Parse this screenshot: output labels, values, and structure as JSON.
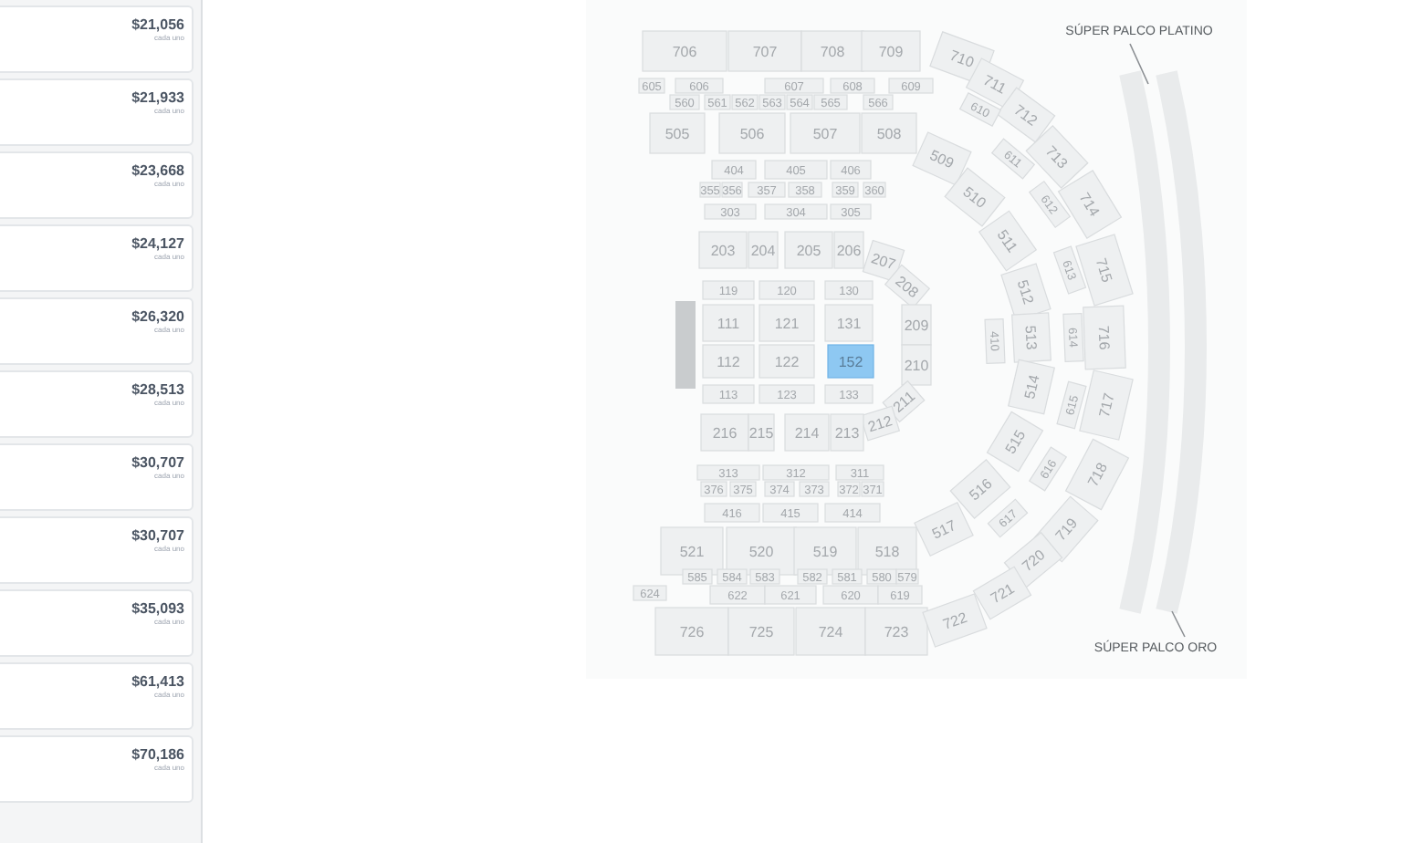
{
  "offers": [
    {
      "price": "$21,056",
      "note": "cada uno"
    },
    {
      "price": "$21,933",
      "note": "cada uno"
    },
    {
      "price": "$23,668",
      "note": "cada uno"
    },
    {
      "price": "$24,127",
      "note": "cada uno"
    },
    {
      "price": "$26,320",
      "note": "cada uno"
    },
    {
      "price": "$28,513",
      "note": "cada uno"
    },
    {
      "price": "$30,707",
      "note": "cada uno"
    },
    {
      "price": "$30,707",
      "note": "cada uno"
    },
    {
      "price": "$35,093",
      "note": "cada uno"
    },
    {
      "price": "$61,413",
      "note": "cada uno"
    },
    {
      "price": "$70,186",
      "note": "cada uno"
    }
  ],
  "seat_map": {
    "sections": [
      {
        "label": "706",
        "selected": false
      },
      {
        "label": "707",
        "selected": false
      },
      {
        "label": "708",
        "selected": false
      },
      {
        "label": "709",
        "selected": false
      },
      {
        "label": "605",
        "selected": false
      },
      {
        "label": "606",
        "selected": false
      },
      {
        "label": "607",
        "selected": false
      },
      {
        "label": "608",
        "selected": false
      },
      {
        "label": "609",
        "selected": false
      },
      {
        "label": "560",
        "selected": false
      },
      {
        "label": "561",
        "selected": false
      },
      {
        "label": "562",
        "selected": false
      },
      {
        "label": "563",
        "selected": false
      },
      {
        "label": "564",
        "selected": false
      },
      {
        "label": "565",
        "selected": false
      },
      {
        "label": "566",
        "selected": false
      },
      {
        "label": "505",
        "selected": false
      },
      {
        "label": "506",
        "selected": false
      },
      {
        "label": "507",
        "selected": false
      },
      {
        "label": "508",
        "selected": false
      },
      {
        "label": "404",
        "selected": false
      },
      {
        "label": "405",
        "selected": false
      },
      {
        "label": "406",
        "selected": false
      },
      {
        "label": "355",
        "selected": false
      },
      {
        "label": "356",
        "selected": false
      },
      {
        "label": "357",
        "selected": false
      },
      {
        "label": "358",
        "selected": false
      },
      {
        "label": "359",
        "selected": false
      },
      {
        "label": "360",
        "selected": false
      },
      {
        "label": "303",
        "selected": false
      },
      {
        "label": "304",
        "selected": false
      },
      {
        "label": "305",
        "selected": false
      },
      {
        "label": "203",
        "selected": false
      },
      {
        "label": "204",
        "selected": false
      },
      {
        "label": "205",
        "selected": false
      },
      {
        "label": "206",
        "selected": false
      },
      {
        "label": "207",
        "selected": false
      },
      {
        "label": "208",
        "selected": false
      },
      {
        "label": "119",
        "selected": false
      },
      {
        "label": "120",
        "selected": false
      },
      {
        "label": "130",
        "selected": false
      },
      {
        "label": "111",
        "selected": false
      },
      {
        "label": "121",
        "selected": false
      },
      {
        "label": "131",
        "selected": false
      },
      {
        "label": "209",
        "selected": false
      },
      {
        "label": "112",
        "selected": false
      },
      {
        "label": "122",
        "selected": false
      },
      {
        "label": "152",
        "selected": true
      },
      {
        "label": "210",
        "selected": false
      },
      {
        "label": "113",
        "selected": false
      },
      {
        "label": "123",
        "selected": false
      },
      {
        "label": "133",
        "selected": false
      },
      {
        "label": "211",
        "selected": false
      },
      {
        "label": "212",
        "selected": false
      },
      {
        "label": "216",
        "selected": false
      },
      {
        "label": "215",
        "selected": false
      },
      {
        "label": "214",
        "selected": false
      },
      {
        "label": "213",
        "selected": false
      },
      {
        "label": "313",
        "selected": false
      },
      {
        "label": "312",
        "selected": false
      },
      {
        "label": "311",
        "selected": false
      },
      {
        "label": "376",
        "selected": false
      },
      {
        "label": "375",
        "selected": false
      },
      {
        "label": "374",
        "selected": false
      },
      {
        "label": "373",
        "selected": false
      },
      {
        "label": "372",
        "selected": false
      },
      {
        "label": "371",
        "selected": false
      },
      {
        "label": "416",
        "selected": false
      },
      {
        "label": "415",
        "selected": false
      },
      {
        "label": "414",
        "selected": false
      },
      {
        "label": "521",
        "selected": false
      },
      {
        "label": "520",
        "selected": false
      },
      {
        "label": "519",
        "selected": false
      },
      {
        "label": "518",
        "selected": false
      },
      {
        "label": "585",
        "selected": false
      },
      {
        "label": "584",
        "selected": false
      },
      {
        "label": "583",
        "selected": false
      },
      {
        "label": "582",
        "selected": false
      },
      {
        "label": "581",
        "selected": false
      },
      {
        "label": "580",
        "selected": false
      },
      {
        "label": "579",
        "selected": false
      },
      {
        "label": "624",
        "selected": false
      },
      {
        "label": "622",
        "selected": false
      },
      {
        "label": "621",
        "selected": false
      },
      {
        "label": "620",
        "selected": false
      },
      {
        "label": "619",
        "selected": false
      },
      {
        "label": "726",
        "selected": false
      },
      {
        "label": "725",
        "selected": false
      },
      {
        "label": "724",
        "selected": false
      },
      {
        "label": "723",
        "selected": false
      },
      {
        "label": "710",
        "selected": false
      },
      {
        "label": "711",
        "selected": false
      },
      {
        "label": "712",
        "selected": false
      },
      {
        "label": "713",
        "selected": false
      },
      {
        "label": "714",
        "selected": false
      },
      {
        "label": "715",
        "selected": false
      },
      {
        "label": "716",
        "selected": false
      },
      {
        "label": "717",
        "selected": false
      },
      {
        "label": "718",
        "selected": false
      },
      {
        "label": "719",
        "selected": false
      },
      {
        "label": "720",
        "selected": false
      },
      {
        "label": "721",
        "selected": false
      },
      {
        "label": "722",
        "selected": false
      },
      {
        "label": "610",
        "selected": false
      },
      {
        "label": "611",
        "selected": false
      },
      {
        "label": "612",
        "selected": false
      },
      {
        "label": "613",
        "selected": false
      },
      {
        "label": "614",
        "selected": false
      },
      {
        "label": "615",
        "selected": false
      },
      {
        "label": "616",
        "selected": false
      },
      {
        "label": "617",
        "selected": false
      },
      {
        "label": "509",
        "selected": false
      },
      {
        "label": "510",
        "selected": false
      },
      {
        "label": "511",
        "selected": false
      },
      {
        "label": "512",
        "selected": false
      },
      {
        "label": "513",
        "selected": false
      },
      {
        "label": "514",
        "selected": false
      },
      {
        "label": "515",
        "selected": false
      },
      {
        "label": "516",
        "selected": false
      },
      {
        "label": "517",
        "selected": false
      },
      {
        "label": "410",
        "selected": false
      }
    ],
    "callouts": [
      {
        "label": "SÚPER PALCO PLATINO"
      },
      {
        "label": "SÚPER PALCO ORO"
      }
    ]
  }
}
